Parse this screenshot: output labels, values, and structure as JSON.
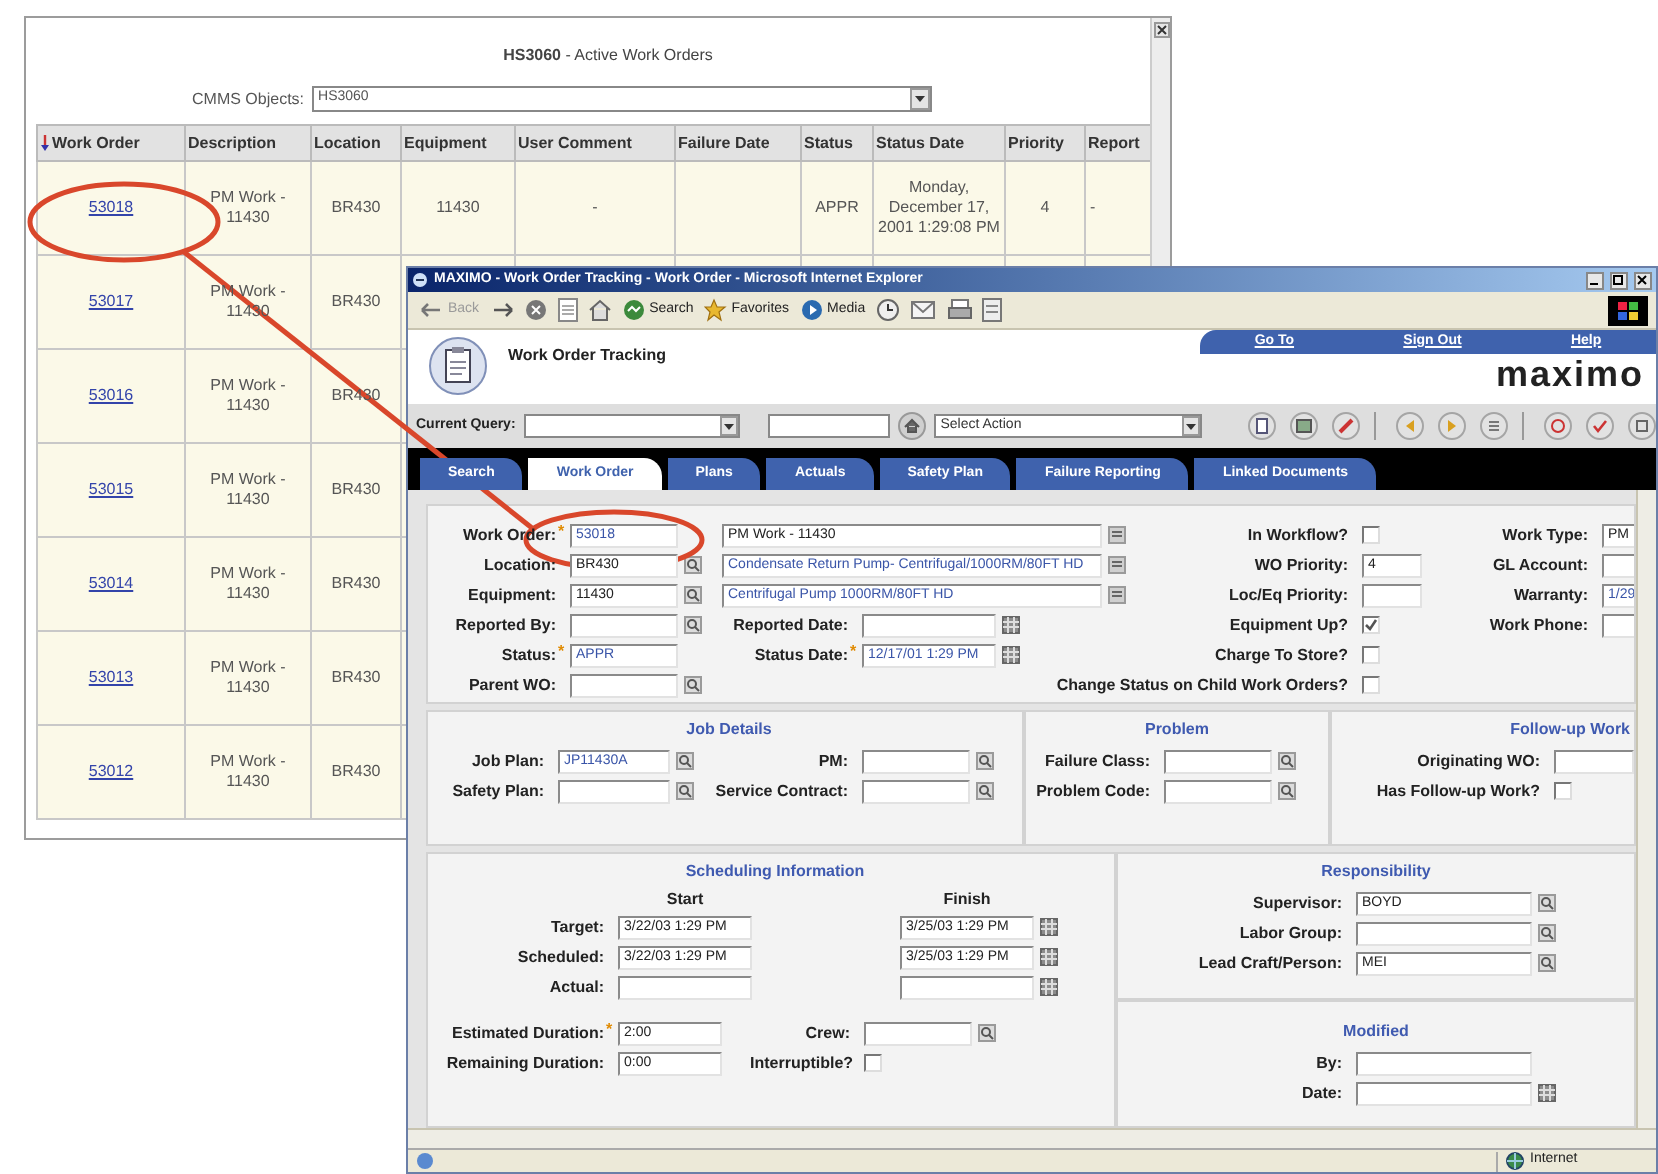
{
  "back_window": {
    "title": "**HS3060** - Active Work Orders",
    "cmms_label": "CMMS Objects:",
    "cmms_value": "HS3060",
    "table": {
      "columns": [
        "Work Order",
        "Description",
        "Location",
        "Equipment",
        "User Comment",
        "Failure Date",
        "Status",
        "Status Date",
        "Priority",
        "Report"
      ],
      "rows": [
        {
          "cells": [
            "53018",
            "PM Work - 11430",
            "BR430",
            "11430",
            "-",
            null,
            "APPR",
            "Monday, December 17, 2001 1:29:08 PM",
            "4",
            "-"
          ]
        },
        {
          "cells": [
            "53017",
            "PM Work - 11430",
            "BR430"
          ]
        },
        {
          "cells": [
            "53016",
            "PM Work - 11430",
            "BR430"
          ]
        },
        {
          "cells": [
            "53015",
            "PM Work - 11430",
            "BR430"
          ]
        },
        {
          "cells": [
            "53014",
            "PM Work - 11430",
            "BR430"
          ]
        },
        {
          "cells": [
            "53013",
            "PM Work - 11430",
            "BR430"
          ]
        },
        {
          "cells": [
            "53012",
            "PM Work - 11430",
            "BR430"
          ]
        }
      ]
    }
  },
  "front_window": {
    "title": "MAXIMO - Work Order Tracking - Work Order - Microsoft Internet Explorer",
    "toolbar": [
      {
        "label": "Back",
        "disabled": true
      },
      {
        "label": "Search",
        "disabled": false
      },
      {
        "label": "Favorites",
        "disabled": false
      },
      {
        "label": "Media",
        "disabled": false
      }
    ],
    "app_title": "Work Order Tracking",
    "header_links": [
      "Go To",
      "Sign Out",
      "Help"
    ],
    "logo": "maximo",
    "query": {
      "label": "Current Query:",
      "action_value": "Select Action"
    },
    "tabs": [
      {
        "label": "Search",
        "selected": false
      },
      {
        "label": "Work Order",
        "selected": true
      },
      {
        "label": "Plans",
        "selected": false
      },
      {
        "label": "Actuals",
        "selected": false
      },
      {
        "label": "Safety Plan",
        "selected": false
      },
      {
        "label": "Failure Reporting",
        "selected": false
      },
      {
        "label": "Linked Documents",
        "selected": false
      }
    ],
    "main_form": [
      {
        "left": {
          "label": "Work Order:",
          "mark": "*",
          "kind": "text",
          "value": "53018",
          "readonly": true
        },
        "middle": {
          "kind": "description",
          "value": "PM Work - 11430",
          "button": {
            "kind": "note"
          }
        },
        "right": {
          "label": "In Workflow?",
          "kind": "checkbox",
          "checked": false
        },
        "far": {
          "label": "Work Type:",
          "kind": "text",
          "value": "PM"
        }
      },
      {
        "left": {
          "label": "Location:",
          "kind": "text",
          "value": "BR430",
          "button": {
            "kind": "lookup"
          }
        },
        "middle": {
          "kind": "description",
          "value": "Condensate Return Pump- Centrifugal/1000RM/80FT HD",
          "readonly": true,
          "button": {
            "kind": "note"
          }
        },
        "right": {
          "label": "WO Priority:",
          "kind": "text",
          "value": "4"
        },
        "far": {
          "label": "GL Account:",
          "kind": "text"
        }
      },
      {
        "left": {
          "label": "Equipment:",
          "kind": "text",
          "value": "11430",
          "button": {
            "kind": "lookup"
          }
        },
        "middle": {
          "kind": "description",
          "value": "Centrifugal Pump 1000RM/80FT HD",
          "readonly": true,
          "button": {
            "kind": "note"
          }
        },
        "right": {
          "label": "Loc/Eq Priority:",
          "kind": "text"
        },
        "far": {
          "label": "Warranty:",
          "kind": "text",
          "value": "1/29",
          "readonly": true
        }
      },
      {
        "left": {
          "label": "Reported By:",
          "kind": "text",
          "button": {
            "kind": "lookup"
          }
        },
        "middle": {
          "kind": "date",
          "label": "Reported Date:",
          "button": {
            "kind": "calendar"
          }
        },
        "right": {
          "label": "Equipment Up?",
          "kind": "checkbox",
          "checked": true
        },
        "far": {
          "label": "Work Phone:",
          "kind": "text"
        }
      },
      {
        "left": {
          "label": "Status:",
          "mark": "*",
          "kind": "text",
          "value": "APPR",
          "readonly": true
        },
        "middle": {
          "kind": "date",
          "label": "Status Date:",
          "mark": "*",
          "value": "12/17/01 1:29 PM",
          "readonly": true,
          "button": {
            "kind": "calendar"
          }
        },
        "right": {
          "label": "Charge To Store?",
          "kind": "checkbox",
          "checked": false
        }
      },
      {
        "left": {
          "label": "Parent WO:",
          "kind": "text",
          "button": {
            "kind": "lookup"
          }
        },
        "right": {
          "label": "Change Status on Child Work Orders?",
          "kind": "checkbox",
          "checked": false
        }
      }
    ],
    "job_details": {
      "title": "Job Details",
      "rows": [
        {
          "left": {
            "label": "Job Plan:",
            "kind": "text",
            "value": "JP11430A",
            "readonly": true,
            "button": {
              "kind": "lookup"
            }
          },
          "right": {
            "label": "PM:",
            "kind": "text",
            "button": {
              "kind": "lookup"
            }
          }
        },
        {
          "left": {
            "label": "Safety Plan:",
            "kind": "text",
            "button": {
              "kind": "lookup"
            }
          },
          "right": {
            "label": "Service Contract:",
            "kind": "text",
            "button": {
              "kind": "lookup"
            }
          }
        }
      ]
    },
    "problem": {
      "title": "Problem",
      "fields": [
        {
          "label": "Failure Class:",
          "kind": "text",
          "button": {
            "kind": "lookup"
          }
        },
        {
          "label": "Problem Code:",
          "kind": "text",
          "button": {
            "kind": "lookup"
          }
        }
      ]
    },
    "follow_up": {
      "title": "Follow-up Work",
      "fields": [
        {
          "label": "Originating WO:",
          "kind": "text"
        },
        {
          "label": "Has Follow-up Work?",
          "kind": "checkbox",
          "checked": false
        }
      ]
    },
    "scheduling": {
      "title": "Scheduling Information",
      "start_heading": "Start",
      "finish_heading": "Finish",
      "rows": [
        {
          "label": "Target:",
          "start": "3/22/03 1:29 PM",
          "finish": "3/25/03 1:29 PM"
        },
        {
          "label": "Scheduled:",
          "start": "3/22/03 1:29 PM",
          "finish": "3/25/03 1:29 PM"
        },
        {
          "label": "Actual:"
        }
      ],
      "durations": [
        {
          "left": {
            "label": "Estimated Duration:",
            "mark": "*",
            "kind": "text",
            "value": "2:00"
          },
          "right": {
            "label": "Crew:",
            "kind": "text",
            "button": {
              "kind": "lookup"
            }
          }
        },
        {
          "left": {
            "label": "Remaining Duration:",
            "kind": "text",
            "value": "0:00"
          },
          "right": {
            "label": "Interruptible?",
            "kind": "checkbox",
            "checked": false
          }
        }
      ]
    },
    "responsibility": {
      "title": "Responsibility",
      "fields": [
        {
          "label": "Supervisor:",
          "kind": "text",
          "value": "BOYD",
          "button": {
            "kind": "lookup"
          }
        },
        {
          "label": "Labor Group:",
          "kind": "text",
          "button": {
            "kind": "lookup"
          }
        },
        {
          "label": "Lead Craft/Person:",
          "kind": "text",
          "value": "MEI",
          "button": {
            "kind": "lookup"
          }
        }
      ]
    },
    "modified": {
      "title": "Modified",
      "fields": [
        {
          "label": "By:",
          "kind": "text"
        },
        {
          "label": "Date:",
          "kind": "text",
          "button": {
            "kind": "calendar"
          }
        }
      ]
    },
    "status_bar": {
      "zone": "Internet"
    }
  }
}
